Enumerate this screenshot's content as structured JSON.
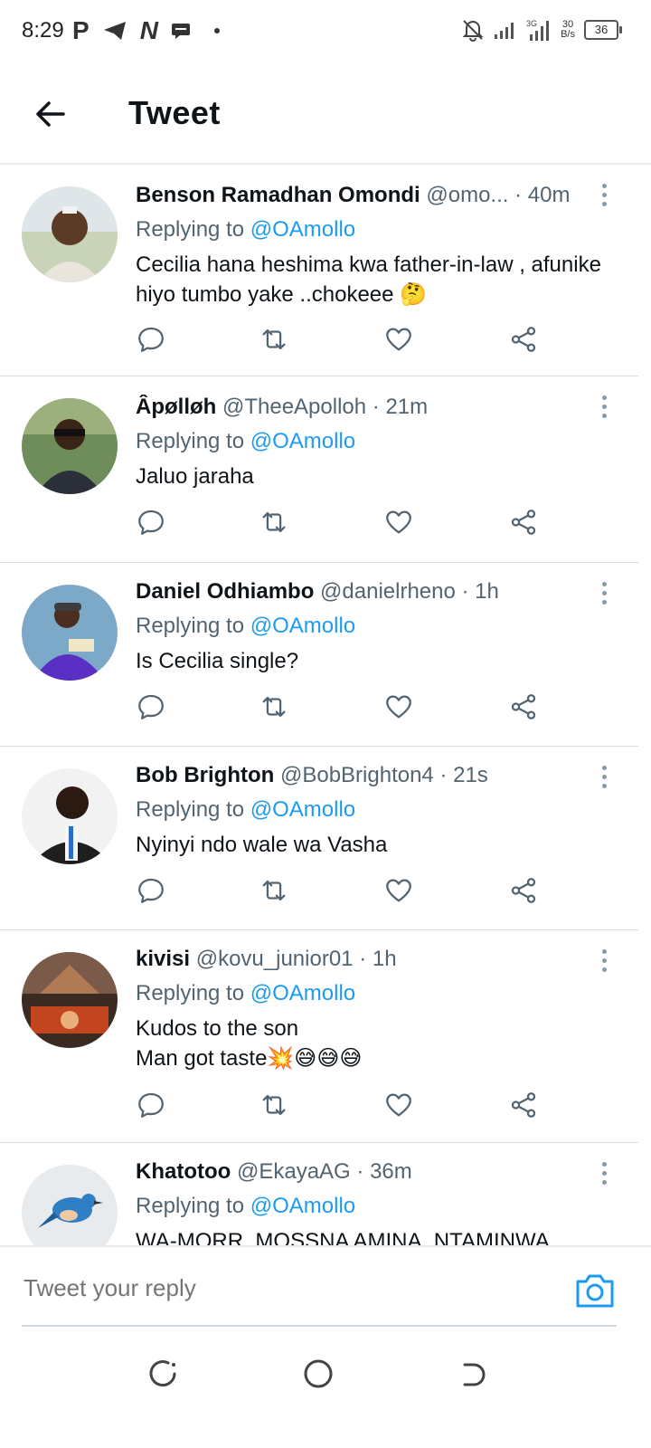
{
  "status_bar": {
    "time": "8:29",
    "speed_value": "30",
    "speed_unit": "B/s",
    "battery": "36",
    "left_icons": [
      "p-app-icon",
      "telegram-icon",
      "n-app-icon",
      "message-icon",
      "dot-icon"
    ],
    "right_icons": [
      "bell-off-icon",
      "signal-icon",
      "3g-signal-icon"
    ]
  },
  "header": {
    "title": "Tweet"
  },
  "tweets": [
    {
      "name": "Benson Ramadhan Omondi",
      "handle": "@omo...",
      "time": " · 40m",
      "replying_prefix": "Replying to ",
      "mention": "@OAmollo",
      "text": "Cecilia hana heshima kwa father-in-law , afunike hiyo tumbo yake ..chokeee 🤔"
    },
    {
      "name": "Âpølløh",
      "handle": "@TheeApolloh",
      "time": " · 21m",
      "replying_prefix": "Replying to ",
      "mention": "@OAmollo",
      "text": "Jaluo jaraha"
    },
    {
      "name": "Daniel Odhiambo",
      "handle": "@danielrheno",
      "time": " · 1h",
      "replying_prefix": "Replying to ",
      "mention": "@OAmollo",
      "text": "Is Cecilia single?"
    },
    {
      "name": "Bob Brighton",
      "handle": "@BobBrighton4",
      "time": " · 21s",
      "replying_prefix": "Replying to ",
      "mention": "@OAmollo",
      "text": "Nyinyi ndo wale wa Vasha"
    },
    {
      "name": "kivisi",
      "handle": "@kovu_junior01",
      "time": " · 1h",
      "replying_prefix": "Replying to ",
      "mention": "@OAmollo",
      "text": "Kudos to the son\nMan got taste💥😅😅😅"
    },
    {
      "name": "Khatotoo",
      "handle": "@EkayaAG",
      "time": " · 36m",
      "replying_prefix": "Replying to ",
      "mention": "@OAmollo",
      "text": "WA-MORR, MOSSNA AMINA, NTAMINWA"
    }
  ],
  "reply_bar": {
    "placeholder": "Tweet your reply"
  },
  "colors": {
    "accent": "#1d9bf0",
    "secondary_text": "#536471",
    "divider": "#d6dde3"
  }
}
